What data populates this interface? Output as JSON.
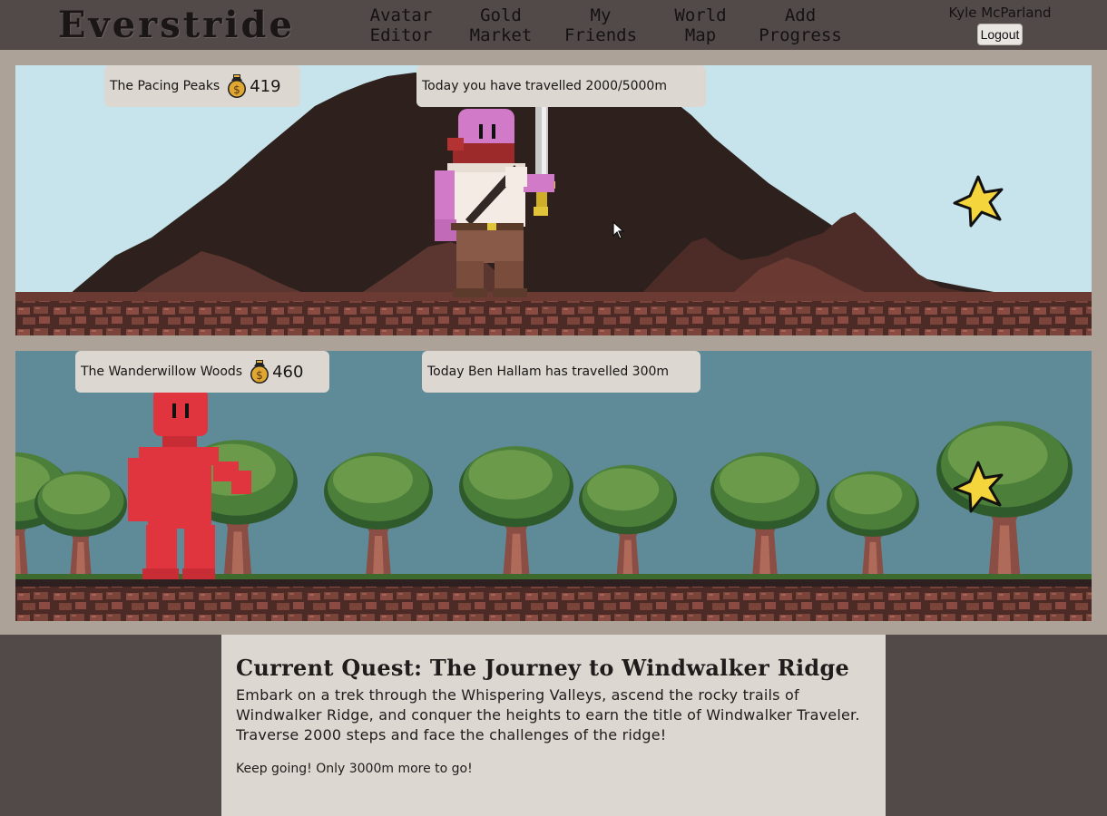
{
  "header": {
    "logo": "Everstride",
    "nav": [
      {
        "line1": "Avatar",
        "line2": "Editor"
      },
      {
        "line1": "Gold",
        "line2": "Market"
      },
      {
        "line1": "My",
        "line2": "Friends"
      },
      {
        "line1": "World",
        "line2": "Map"
      },
      {
        "line1": "Add",
        "line2": "Progress"
      }
    ],
    "user_name": "Kyle McParland",
    "logout_label": "Logout"
  },
  "scenes": [
    {
      "location": "The Pacing Peaks",
      "coins": "419",
      "status": "Today you have travelled 2000/5000m",
      "character_color": "#d17ac8",
      "sky_color": "#c7e4ec"
    },
    {
      "location": "The Wanderwillow Woods",
      "coins": "460",
      "status": "Today Ben Hallam has travelled 300m",
      "character_color": "#e0353e",
      "sky_color": "#5e8b97"
    }
  ],
  "icons": {
    "coin": "coin-bag-icon",
    "goal": "star-icon",
    "cursor": "mouse-pointer-icon"
  },
  "quest": {
    "title": "Current Quest: The Journey to Windwalker Ridge",
    "description": "Embark on a trek through the Whispering Valleys, ascend the rocky trails of Windwalker Ridge, and conquer the heights to earn the title of Windwalker Traveler. Traverse 2000 steps and face the challenges of the ridge!",
    "remaining": "Keep going! Only 3000m more to go!"
  },
  "colors": {
    "header_bg": "#524a48",
    "page_bg": "#ada297",
    "card_bg": "#ddd7d1",
    "star_fill": "#f5d53c"
  }
}
